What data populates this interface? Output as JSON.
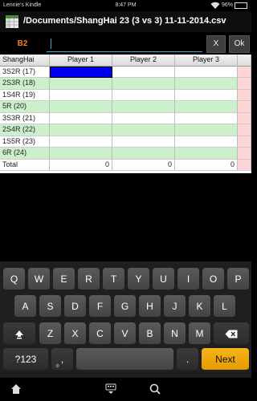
{
  "status_bar": {
    "device_name": "Lennie's Kindle",
    "time": "8:47 PM",
    "battery": "96%"
  },
  "title_bar": {
    "title": "/Documents/ShangHai 23 (3 vs 3) 11-11-2014.csv"
  },
  "input_bar": {
    "cell_reference": "B2",
    "formula_value": "",
    "cancel_label": "X",
    "ok_label": "Ok"
  },
  "sheet": {
    "headers": [
      "ShangHai",
      "Player 1",
      "Player 2",
      "Player 3",
      ""
    ],
    "rows": [
      {
        "label": "3S2R (17)",
        "values": [
          "",
          "",
          "",
          ""
        ]
      },
      {
        "label": "2S3R (18)",
        "values": [
          "",
          "",
          "",
          ""
        ]
      },
      {
        "label": "1S4R (19)",
        "values": [
          "",
          "",
          "",
          ""
        ]
      },
      {
        "label": "5R (20)",
        "values": [
          "",
          "",
          "",
          ""
        ]
      },
      {
        "label": "3S3R (21)",
        "values": [
          "",
          "",
          "",
          ""
        ]
      },
      {
        "label": "2S4R (22)",
        "values": [
          "",
          "",
          "",
          ""
        ]
      },
      {
        "label": "1S5R (23)",
        "values": [
          "",
          "",
          "",
          ""
        ]
      },
      {
        "label": "6R (24)",
        "values": [
          "",
          "",
          "",
          ""
        ]
      }
    ],
    "total": {
      "label": "Total",
      "values": [
        "0",
        "0",
        "0",
        ""
      ]
    }
  },
  "keyboard": {
    "row1": [
      "Q",
      "W",
      "E",
      "R",
      "T",
      "Y",
      "U",
      "I",
      "O",
      "P"
    ],
    "row2": [
      "A",
      "S",
      "D",
      "F",
      "G",
      "H",
      "J",
      "K",
      "L"
    ],
    "row3": [
      "Z",
      "X",
      "C",
      "V",
      "B",
      "N",
      "M"
    ],
    "symbols_label": "?123",
    "comma_label": ",",
    "period_label": ".",
    "next_label": "Next",
    "shift_icon": "shift-icon",
    "backspace_icon": "backspace-icon"
  },
  "colors": {
    "accent_orange": "#ff7b1a",
    "accent_blue": "#3aa7d9",
    "selected_cell": "#0000ee",
    "row_green": "#ccf0cc",
    "column_pink": "#ffd6d6",
    "next_key": "#f5b51b"
  }
}
